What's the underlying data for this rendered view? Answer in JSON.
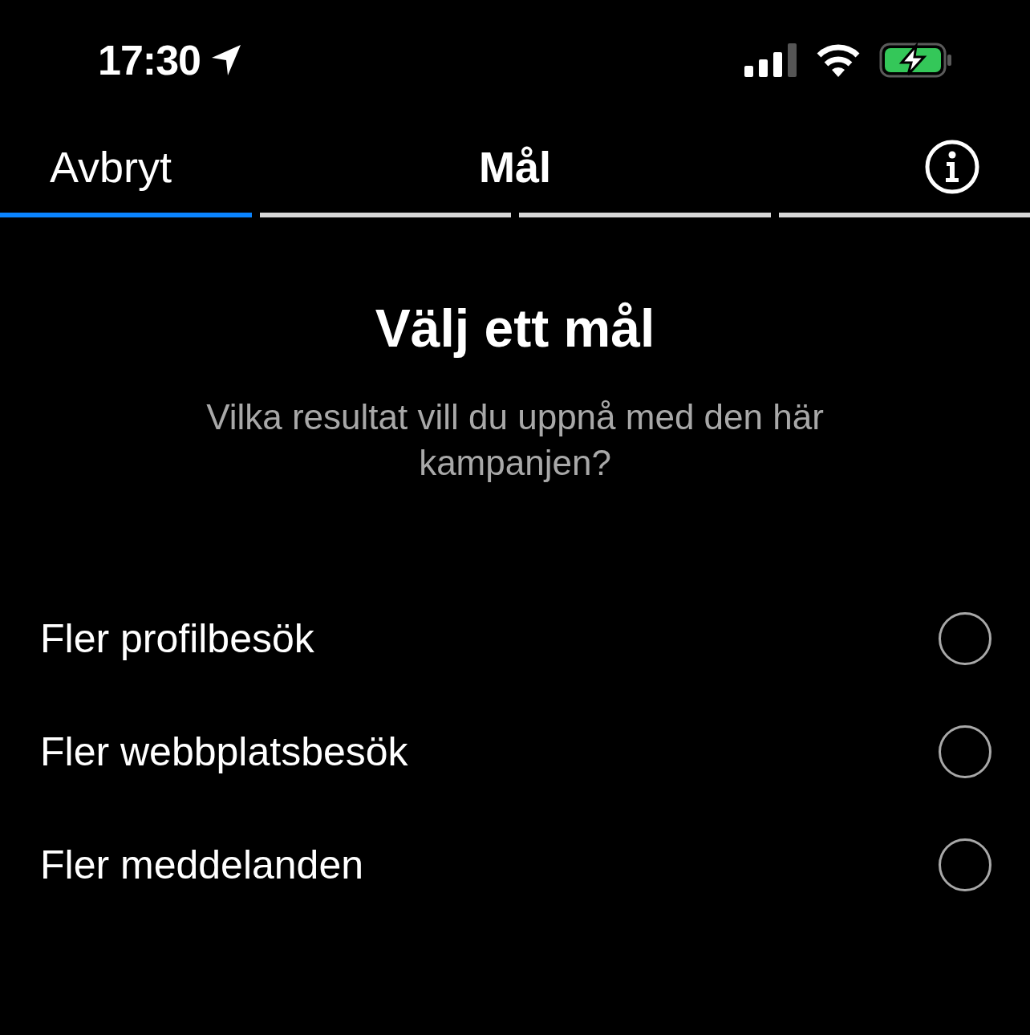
{
  "status_bar": {
    "time": "17:30",
    "charging": true
  },
  "nav": {
    "cancel": "Avbryt",
    "title": "Mål"
  },
  "steps": [
    {
      "completed": true
    },
    {
      "completed": false
    },
    {
      "completed": false
    },
    {
      "completed": false
    }
  ],
  "heading": "Välj ett mål",
  "subtitle": "Vilka resultat vill du uppnå med den här kampanjen?",
  "options": [
    {
      "label": "Fler profilbesök",
      "selected": false
    },
    {
      "label": "Fler webbplatsbesök",
      "selected": false
    },
    {
      "label": "Fler meddelanden",
      "selected": false
    }
  ]
}
